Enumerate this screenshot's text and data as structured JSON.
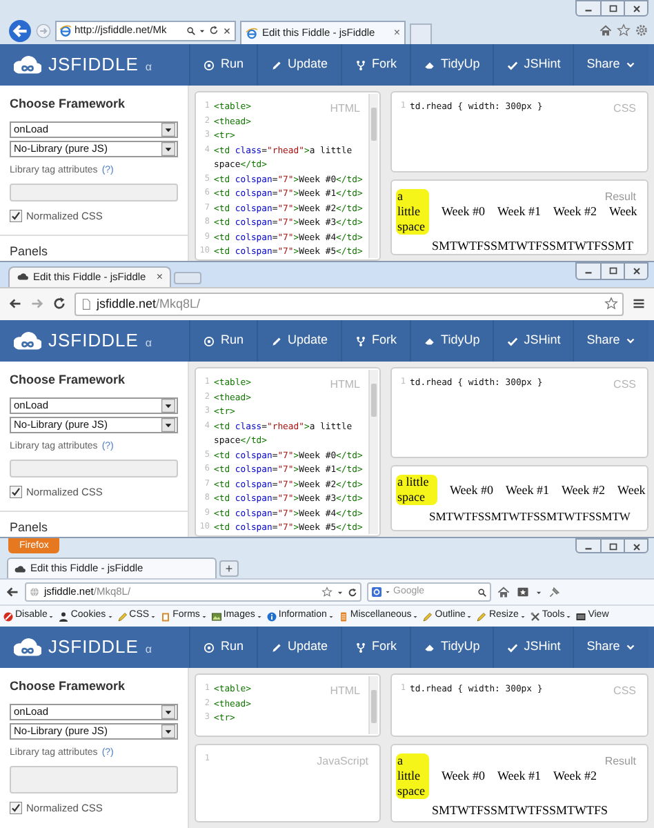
{
  "windows": [
    {
      "kind": "ie",
      "address": {
        "text": "http://jsfiddle.net/Mk"
      },
      "tab": {
        "title": "Edit this Fiddle - jsFiddle",
        "close": "×"
      },
      "app": {
        "logo": "JSFIDDLE",
        "version": "α",
        "actions": [
          {
            "label": "Run"
          },
          {
            "label": "Update"
          },
          {
            "label": "Fork"
          },
          {
            "label": "TidyUp"
          },
          {
            "label": "JSHint"
          },
          {
            "label": "Share"
          }
        ],
        "sidebar": {
          "heading": "Choose Framework",
          "selects": [
            "onLoad",
            "No-Library (pure JS)"
          ],
          "library_label": "Library tag attributes",
          "help": "(?)",
          "normalized_css": {
            "label": "Normalized CSS",
            "checked": true
          },
          "panels_heading": "Panels"
        },
        "html_panel": {
          "label": "HTML",
          "lines": [
            {
              "number": "1",
              "code": "<table>"
            },
            {
              "number": "2",
              "code": "<thead>"
            },
            {
              "number": "3",
              "code": "<tr>"
            },
            {
              "number": "4",
              "code": "<td class=\"rhead\">a little"
            },
            {
              "code": "space</td>"
            },
            {
              "number": "5",
              "code": "<td colspan=\"7\">Week #0</td>"
            },
            {
              "number": "6",
              "code": "<td colspan=\"7\">Week #1</td>"
            },
            {
              "number": "7",
              "code": "<td colspan=\"7\">Week #2</td>"
            },
            {
              "number": "8",
              "code": "<td colspan=\"7\">Week #3</td>"
            },
            {
              "number": "9",
              "code": "<td colspan=\"7\">Week #4</td>"
            },
            {
              "number": "10",
              "code": "<td colspan=\"7\">Week #5</td>"
            }
          ]
        },
        "css_panel": {
          "label": "CSS",
          "lines": [
            {
              "number": "1",
              "code": "td.rhead { width: 300px }"
            }
          ]
        },
        "result": {
          "label": "Result",
          "row_header": "a little space",
          "weeks": [
            "Week #0",
            "Week #1",
            "Week #2",
            "Week"
          ],
          "days": "SMTWTFSSMTWTFSSMTWTFSSMT"
        }
      }
    },
    {
      "kind": "chrome",
      "address": {
        "host": "jsfiddle.net",
        "path": "/Mkq8L/"
      },
      "tab": {
        "title": "Edit this Fiddle - jsFiddle",
        "close": "×"
      },
      "app": {
        "logo": "JSFIDDLE",
        "version": "α",
        "actions": [
          {
            "label": "Run"
          },
          {
            "label": "Update"
          },
          {
            "label": "Fork"
          },
          {
            "label": "TidyUp"
          },
          {
            "label": "JSHint"
          },
          {
            "label": "Share"
          }
        ],
        "sidebar": {
          "heading": "Choose Framework",
          "selects": [
            "onLoad",
            "No-Library (pure JS)"
          ],
          "library_label": "Library tag attributes",
          "help": "(?)",
          "normalized_css": {
            "label": "Normalized CSS",
            "checked": true
          },
          "panels_heading": "Panels"
        },
        "html_panel": {
          "label": "HTML",
          "lines": [
            {
              "number": "1",
              "code": "<table>"
            },
            {
              "number": "2",
              "code": "<thead>"
            },
            {
              "number": "3",
              "code": "<tr>"
            },
            {
              "number": "4",
              "code": "<td class=\"rhead\">a little"
            },
            {
              "code": "space</td>"
            },
            {
              "number": "5",
              "code": "<td colspan=\"7\">Week #0</td>"
            },
            {
              "number": "6",
              "code": "<td colspan=\"7\">Week #1</td>"
            },
            {
              "number": "7",
              "code": "<td colspan=\"7\">Week #2</td>"
            },
            {
              "number": "8",
              "code": "<td colspan=\"7\">Week #3</td>"
            },
            {
              "number": "9",
              "code": "<td colspan=\"7\">Week #4</td>"
            },
            {
              "number": "10",
              "code": "<td colspan=\"7\">Week #5</td>"
            }
          ]
        },
        "css_panel": {
          "label": "CSS",
          "lines": [
            {
              "number": "1",
              "code": "td.rhead { width: 300px }"
            }
          ]
        },
        "result": {
          "row_header": "a little space",
          "weeks": [
            "Week #0",
            "Week #1",
            "Week #2",
            "Week"
          ],
          "days": "SMTWTFSSMTWTFSSMTWTFSSMTW"
        }
      }
    },
    {
      "kind": "firefox",
      "menu_button": "Firefox",
      "address": {
        "host": "jsfiddle.net",
        "path": "/Mkq8L/"
      },
      "tab": {
        "title": "Edit this Fiddle - jsFiddle"
      },
      "new_tab": "+",
      "search": {
        "placeholder": "Google"
      },
      "toolbar": [
        {
          "label": "Disable",
          "dropdown": true
        },
        {
          "label": "Cookies",
          "dropdown": true
        },
        {
          "label": "CSS",
          "dropdown": true
        },
        {
          "label": "Forms",
          "dropdown": true
        },
        {
          "label": "Images",
          "dropdown": true
        },
        {
          "label": "Information",
          "dropdown": true
        },
        {
          "label": "Miscellaneous",
          "dropdown": true
        },
        {
          "label": "Outline",
          "dropdown": true
        },
        {
          "label": "Resize",
          "dropdown": true
        },
        {
          "label": "Tools",
          "dropdown": true
        },
        {
          "label": "View",
          "dropdown": false
        }
      ],
      "app": {
        "logo": "JSFIDDLE",
        "version": "α",
        "actions": [
          {
            "label": "Run"
          },
          {
            "label": "Update"
          },
          {
            "label": "Fork"
          },
          {
            "label": "TidyUp"
          },
          {
            "label": "JSHint"
          },
          {
            "label": "Share"
          }
        ],
        "sidebar": {
          "heading": "Choose Framework",
          "selects": [
            "onLoad",
            "No-Library (pure JS)"
          ],
          "library_label": "Library tag attributes",
          "help": "(?)",
          "normalized_css": {
            "label": "Normalized CSS",
            "checked": true
          }
        },
        "html_panel": {
          "label": "HTML",
          "lines": [
            {
              "number": "1",
              "code": "<table>"
            },
            {
              "number": "2",
              "code": "<thead>"
            },
            {
              "number": "3",
              "code": "<tr>"
            }
          ]
        },
        "js_panel": {
          "label": "JavaScript",
          "lines": [
            {
              "number": "1"
            }
          ]
        },
        "css_panel": {
          "label": "CSS",
          "lines": [
            {
              "number": "1",
              "code": "td.rhead { width: 300px }"
            }
          ]
        },
        "result": {
          "label": "Result",
          "row_header": "a little space",
          "weeks": [
            "Week #0",
            "Week #1",
            "Week #2"
          ],
          "days": "SMTWTFSSMTWTFSSMTWTFS"
        }
      }
    }
  ]
}
